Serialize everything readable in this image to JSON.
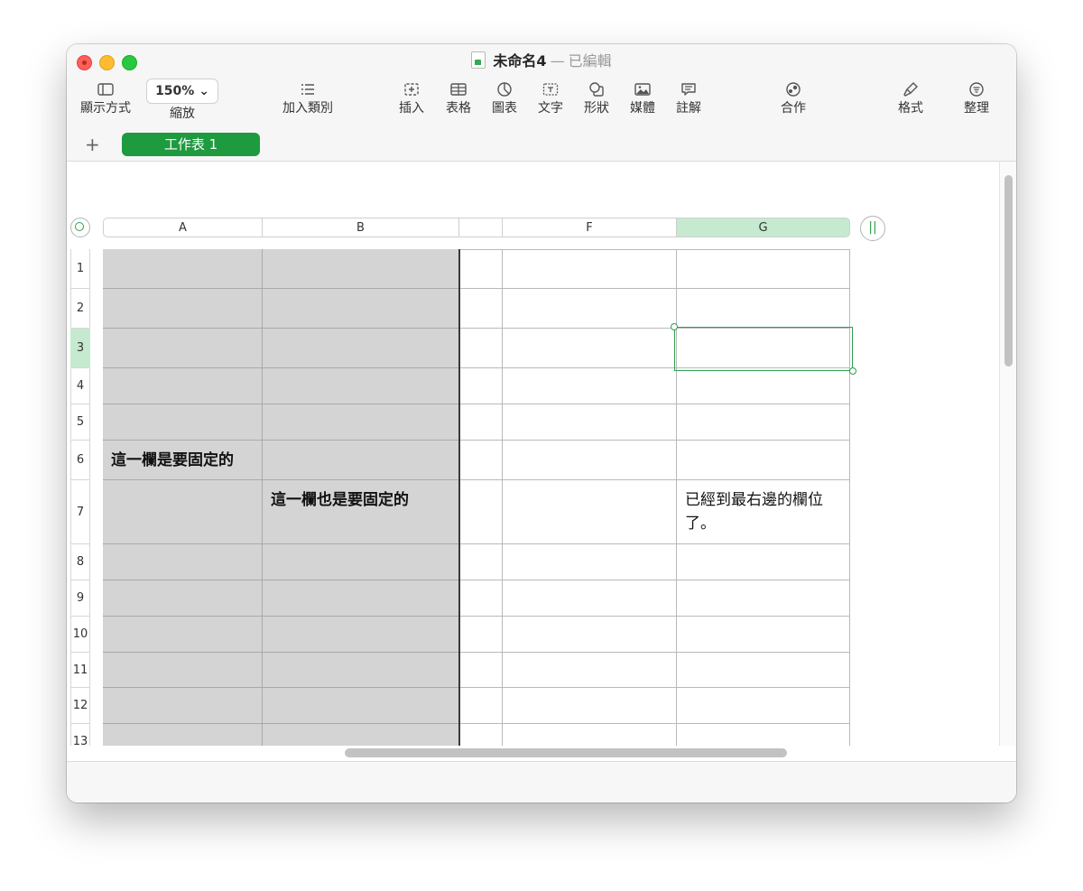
{
  "window": {
    "doc_name": "未命名4",
    "separator": "—",
    "status": "已編輯"
  },
  "toolbar": {
    "view_label": "顯示方式",
    "zoom_value": "150% ⌄",
    "zoom_label": "縮放",
    "category_label": "加入類別",
    "insert_label": "插入",
    "table_label": "表格",
    "chart_label": "圖表",
    "text_label": "文字",
    "shape_label": "形狀",
    "media_label": "媒體",
    "comment_label": "註解",
    "collaborate_label": "合作",
    "format_label": "格式",
    "organize_label": "整理"
  },
  "sheets": {
    "add_symbol": "+",
    "active_tab": "工作表 1"
  },
  "grid": {
    "columns": [
      "A",
      "B",
      "",
      "F",
      "G"
    ],
    "selected_column": "G",
    "rows": [
      "1",
      "2",
      "3",
      "4",
      "5",
      "6",
      "7",
      "8",
      "9",
      "10",
      "11",
      "12",
      "13"
    ],
    "selected_row": "3",
    "cells": {
      "A6": "這一欄是要固定的",
      "B7": "這一欄也是要固定的",
      "G7": "已經到最右邊的欄位了。"
    }
  },
  "accent_color": "#1e9a3f",
  "selection_color": "#c5eacf"
}
